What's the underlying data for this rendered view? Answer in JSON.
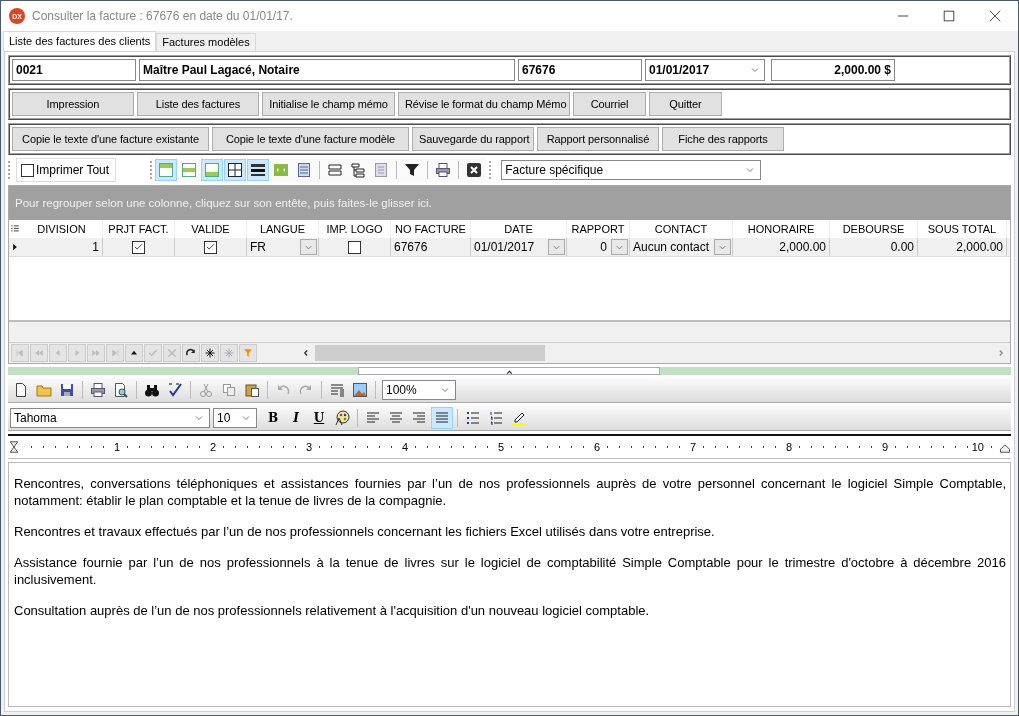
{
  "window": {
    "logo": "DX",
    "title": "Consulter la facture : 67676 en date du 01/01/17."
  },
  "tabs": [
    {
      "label": "Liste des factures des clients",
      "selected": true
    },
    {
      "label": "Factures modèles",
      "selected": false
    }
  ],
  "header_fields": [
    {
      "kind": "text",
      "value": "0021"
    },
    {
      "kind": "text",
      "value": "Maître Paul Lagacé, Notaire"
    },
    {
      "kind": "text",
      "value": "67676"
    },
    {
      "kind": "dropdown",
      "value": "01/01/2017"
    },
    {
      "kind": "amount",
      "value": "2,000.00 $"
    }
  ],
  "button_rows": [
    [
      "Impression",
      "Liste des factures",
      "Initialise le champ mémo",
      "Révise le format du champ Mémo",
      "Courriel",
      "Quitter"
    ],
    [
      "Copie le texte d'une facture existante",
      "Copie le texte d'une facture modèle",
      "Sauvegarde du rapport",
      "Rapport personnalisé",
      "Fiche des rapports"
    ]
  ],
  "grid_toolbar": {
    "print_all": {
      "label": "Imprimer Tout",
      "checked": false
    },
    "report_select": {
      "value": "Facture spécifique"
    }
  },
  "group_hint": "Pour regrouper selon une colonne, cliquez sur son entête, puis faites-le glisser ici.",
  "table": {
    "columns": [
      "DIVISION",
      "PRJT FACT.",
      "VALIDE",
      "LANGUE",
      "IMP. LOGO",
      "NO FACTURE",
      "DATE",
      "RAPPORT",
      "CONTACT",
      "HONORAIRE",
      "DEBOURSE",
      "SOUS TOTAL"
    ],
    "rows": [
      {
        "selected": true,
        "cells": [
          {
            "kind": "number",
            "value": "1"
          },
          {
            "kind": "check",
            "checked": true
          },
          {
            "kind": "check",
            "checked": true
          },
          {
            "kind": "combo",
            "value": "FR"
          },
          {
            "kind": "check",
            "checked": false
          },
          {
            "kind": "text",
            "value": "67676"
          },
          {
            "kind": "combo",
            "value": "01/01/2017"
          },
          {
            "kind": "combo_number",
            "value": "0"
          },
          {
            "kind": "combo",
            "value": "Aucun contact"
          },
          {
            "kind": "number",
            "value": "2,000.00"
          },
          {
            "kind": "number",
            "value": "0.00"
          },
          {
            "kind": "number",
            "value": "2,000.00"
          }
        ]
      }
    ]
  },
  "editor": {
    "zoom": "100%",
    "font": "Tahoma",
    "size": "10",
    "format_buttons": [
      "B",
      "I",
      "U"
    ],
    "alignment_buttons": [
      {
        "selected": false
      },
      {
        "selected": false
      },
      {
        "selected": false
      },
      {
        "selected": true
      }
    ],
    "ruler": [
      "1",
      "2",
      "3",
      "4",
      "5",
      "6",
      "7",
      "8",
      "9",
      "10"
    ],
    "paragraphs": [
      "Rencontres, conversations téléphoniques et assistances fournies par l’un de nos professionnels auprès de votre personnel concernant le logiciel Simple Comptable, notamment: établir le plan comptable et la tenue de livres de la compagnie.",
      "Rencontres et travaux effectués par l’un de nos professionnels concernant les fichiers Excel utilisés dans votre entreprise.",
      "Assistance fournie par l’un de nos professionnels à la tenue de livres sur le logiciel de comptabilité Simple Comptable pour le trimestre d'octobre à décembre 2016 inclusivement.",
      "Consultation auprès de l’un de nos professionnels relativement à l'acquisition d'un nouveau logiciel comptable."
    ]
  }
}
